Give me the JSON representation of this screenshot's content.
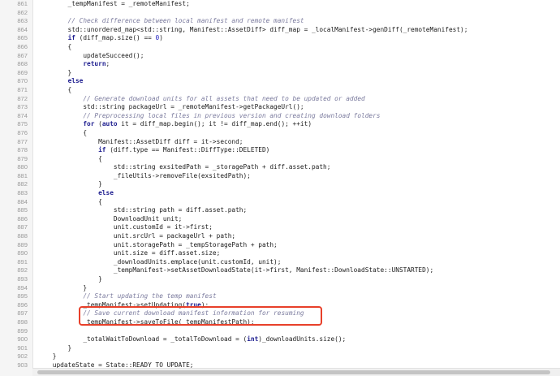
{
  "lines": [
    {
      "num": "861",
      "segs": [
        [
          "t",
          "        _tempManifest = _remoteManifest;"
        ]
      ]
    },
    {
      "num": "862",
      "segs": [
        [
          "t",
          ""
        ]
      ]
    },
    {
      "num": "863",
      "segs": [
        [
          "t",
          "        "
        ],
        [
          "c",
          "// Check difference between local manifest and remote manifest"
        ]
      ]
    },
    {
      "num": "864",
      "segs": [
        [
          "t",
          "        std::unordered_map<std::string, Manifest::AssetDiff> diff_map = _localManifest->genDiff(_remoteManifest);"
        ]
      ]
    },
    {
      "num": "865",
      "segs": [
        [
          "t",
          "        "
        ],
        [
          "k",
          "if"
        ],
        [
          "t",
          " (diff_map.size() == "
        ],
        [
          "n",
          "0"
        ],
        [
          "t",
          ")"
        ]
      ]
    },
    {
      "num": "866",
      "segs": [
        [
          "t",
          "        {"
        ]
      ]
    },
    {
      "num": "867",
      "segs": [
        [
          "t",
          "            updateSucceed();"
        ]
      ]
    },
    {
      "num": "868",
      "segs": [
        [
          "t",
          "            "
        ],
        [
          "k",
          "return"
        ],
        [
          "t",
          ";"
        ]
      ]
    },
    {
      "num": "869",
      "segs": [
        [
          "t",
          "        }"
        ]
      ]
    },
    {
      "num": "870",
      "segs": [
        [
          "t",
          "        "
        ],
        [
          "k",
          "else"
        ]
      ]
    },
    {
      "num": "871",
      "segs": [
        [
          "t",
          "        {"
        ]
      ]
    },
    {
      "num": "872",
      "segs": [
        [
          "t",
          "            "
        ],
        [
          "c",
          "// Generate download units for all assets that need to be updated or added"
        ]
      ]
    },
    {
      "num": "873",
      "segs": [
        [
          "t",
          "            std::string packageUrl = _remoteManifest->getPackageUrl();"
        ]
      ]
    },
    {
      "num": "874",
      "segs": [
        [
          "t",
          "            "
        ],
        [
          "c",
          "// Preprocessing local files in previous version and creating download folders"
        ]
      ]
    },
    {
      "num": "875",
      "segs": [
        [
          "t",
          "            "
        ],
        [
          "k",
          "for"
        ],
        [
          "t",
          " ("
        ],
        [
          "k",
          "auto"
        ],
        [
          "t",
          " it = diff_map.begin(); it != diff_map.end(); ++it)"
        ]
      ]
    },
    {
      "num": "876",
      "segs": [
        [
          "t",
          "            {"
        ]
      ]
    },
    {
      "num": "877",
      "segs": [
        [
          "t",
          "                Manifest::AssetDiff diff = it->second;"
        ]
      ]
    },
    {
      "num": "878",
      "segs": [
        [
          "t",
          "                "
        ],
        [
          "k",
          "if"
        ],
        [
          "t",
          " (diff.type == Manifest::DiffType::DELETED)"
        ]
      ]
    },
    {
      "num": "879",
      "segs": [
        [
          "t",
          "                {"
        ]
      ]
    },
    {
      "num": "880",
      "segs": [
        [
          "t",
          "                    std::string exsitedPath = _storagePath + diff.asset.path;"
        ]
      ]
    },
    {
      "num": "881",
      "segs": [
        [
          "t",
          "                    _fileUtils->removeFile(exsitedPath);"
        ]
      ]
    },
    {
      "num": "882",
      "segs": [
        [
          "t",
          "                }"
        ]
      ]
    },
    {
      "num": "883",
      "segs": [
        [
          "t",
          "                "
        ],
        [
          "k",
          "else"
        ]
      ]
    },
    {
      "num": "884",
      "segs": [
        [
          "t",
          "                {"
        ]
      ]
    },
    {
      "num": "885",
      "segs": [
        [
          "t",
          "                    std::string path = diff.asset.path;"
        ]
      ]
    },
    {
      "num": "886",
      "segs": [
        [
          "t",
          "                    DownloadUnit unit;"
        ]
      ]
    },
    {
      "num": "887",
      "segs": [
        [
          "t",
          "                    unit.customId = it->first;"
        ]
      ]
    },
    {
      "num": "888",
      "segs": [
        [
          "t",
          "                    unit.srcUrl = packageUrl + path;"
        ]
      ]
    },
    {
      "num": "889",
      "segs": [
        [
          "t",
          "                    unit.storagePath = _tempStoragePath + path;"
        ]
      ]
    },
    {
      "num": "890",
      "segs": [
        [
          "t",
          "                    unit.size = diff.asset.size;"
        ]
      ]
    },
    {
      "num": "891",
      "segs": [
        [
          "t",
          "                    _downloadUnits.emplace(unit.customId, unit);"
        ]
      ]
    },
    {
      "num": "892",
      "segs": [
        [
          "t",
          "                    _tempManifest->setAssetDownloadState(it->first, Manifest::DownloadState::UNSTARTED);"
        ]
      ]
    },
    {
      "num": "893",
      "segs": [
        [
          "t",
          "                }"
        ]
      ]
    },
    {
      "num": "894",
      "segs": [
        [
          "t",
          "            }"
        ]
      ]
    },
    {
      "num": "895",
      "segs": [
        [
          "t",
          "            "
        ],
        [
          "c",
          "// Start updating the temp manifest"
        ]
      ]
    },
    {
      "num": "896",
      "segs": [
        [
          "t",
          "            _tempManifest->setUpdating("
        ],
        [
          "k",
          "true"
        ],
        [
          "t",
          ");"
        ]
      ]
    },
    {
      "num": "897",
      "segs": [
        [
          "t",
          "            "
        ],
        [
          "c",
          "// Save current download manifest information for resuming"
        ]
      ]
    },
    {
      "num": "898",
      "segs": [
        [
          "t",
          "            _tempManifest->saveToFile(_tempManifestPath);"
        ]
      ]
    },
    {
      "num": "899",
      "segs": [
        [
          "t",
          ""
        ]
      ]
    },
    {
      "num": "900",
      "segs": [
        [
          "t",
          "            _totalWaitToDownload = _totalToDownload = ("
        ],
        [
          "k",
          "int"
        ],
        [
          "t",
          ")_downloadUnits.size();"
        ]
      ]
    },
    {
      "num": "901",
      "segs": [
        [
          "t",
          "        }"
        ]
      ]
    },
    {
      "num": "902",
      "segs": [
        [
          "t",
          "    }"
        ]
      ]
    },
    {
      "num": "903",
      "segs": [
        [
          "t",
          "    updateState = State::READY_TO_UPDATE;"
        ]
      ]
    }
  ],
  "highlight": {
    "from_line": "897",
    "to_line": "898",
    "color": "#e8402a"
  },
  "colors": {
    "comment": "#7b7b9e",
    "keyword": "#1d1d8f",
    "number": "#2020c0",
    "gutter": "#f5f5f5"
  }
}
